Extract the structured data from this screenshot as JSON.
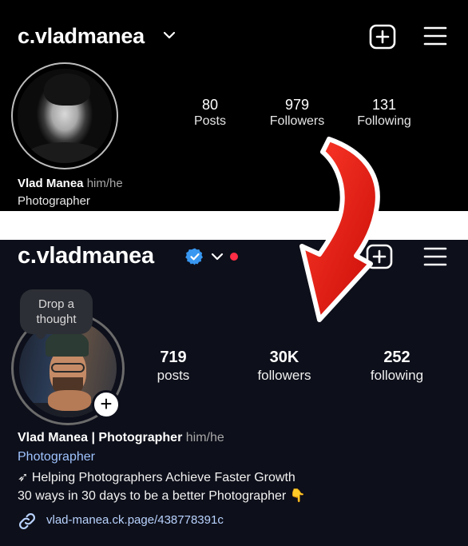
{
  "before": {
    "username": "c.vladmanea",
    "icons": {
      "dropdown": "chevron-down-icon",
      "create": "plus-square-icon",
      "menu": "hamburger-menu-icon"
    },
    "stats": [
      {
        "value": "80",
        "label": "Posts"
      },
      {
        "value": "979",
        "label": "Followers"
      },
      {
        "value": "131",
        "label": "Following"
      }
    ],
    "name": "Vlad Manea",
    "pronouns": "him/he",
    "category": "Photographer"
  },
  "after": {
    "username": "c.vladmanea",
    "icons": {
      "verified": "verified-badge-icon",
      "dropdown": "chevron-down-icon",
      "notification": "red-dot-icon",
      "create": "plus-square-icon",
      "menu": "hamburger-menu-icon",
      "add_story": "plus-icon",
      "link": "link-icon"
    },
    "note_bubble": "Drop a thought",
    "stats": [
      {
        "value": "719",
        "label": "posts"
      },
      {
        "value": "30K",
        "label": "followers"
      },
      {
        "value": "252",
        "label": "following"
      }
    ],
    "name": "Vlad Manea | Photographer",
    "pronouns": "him/he",
    "category": "Photographer",
    "bio_line1": "➶ Helping Photographers Achieve Faster Growth",
    "bio_line2": "30 ways in 30 days to be a better Photographer 👇",
    "link": "vlad-manea.ck.page/438778391c"
  },
  "colors": {
    "arrow": "#e8160f",
    "verified": "#3897f0",
    "link_text": "#b9d3ff",
    "category_text": "#9fc3ff"
  }
}
